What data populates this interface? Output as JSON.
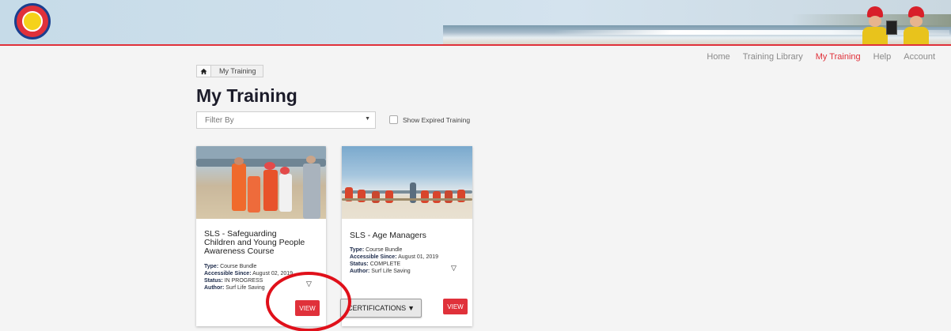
{
  "logo": {
    "icon": "surf-life-saving-logo-icon"
  },
  "nav": {
    "items": [
      {
        "label": "Home",
        "active": false
      },
      {
        "label": "Training Library",
        "active": false
      },
      {
        "label": "My Training",
        "active": true
      },
      {
        "label": "Help",
        "active": false
      },
      {
        "label": "Account",
        "active": false
      }
    ]
  },
  "breadcrumb": {
    "home_icon": "home-icon",
    "current": "My Training"
  },
  "page": {
    "title": "My Training"
  },
  "filter": {
    "placeholder": "Filter By",
    "expired_label": "Show Expired Training",
    "expired_checked": false
  },
  "cards": [
    {
      "title": "SLS - Safeguarding Children and Young People Awareness Course",
      "type_label": "Type:",
      "type": "Course Bundle",
      "since_label": "Accessible Since:",
      "since": "August 02, 2019",
      "status_label": "Status:",
      "status": "IN PROGRESS",
      "author_label": "Author:",
      "author": "Surf Life Saving",
      "view_label": "VIEW"
    },
    {
      "title": "SLS - Age Managers",
      "type_label": "Type:",
      "type": "Course Bundle",
      "since_label": "Accessible Since:",
      "since": "August 01, 2019",
      "status_label": "Status:",
      "status": "COMPLETE",
      "author_label": "Author:",
      "author": "Surf Life Saving",
      "certifications_label": "CERTIFICATIONS",
      "view_label": "VIEW"
    }
  ],
  "colors": {
    "accent": "#e0313a",
    "title": "#1c1c2a"
  }
}
